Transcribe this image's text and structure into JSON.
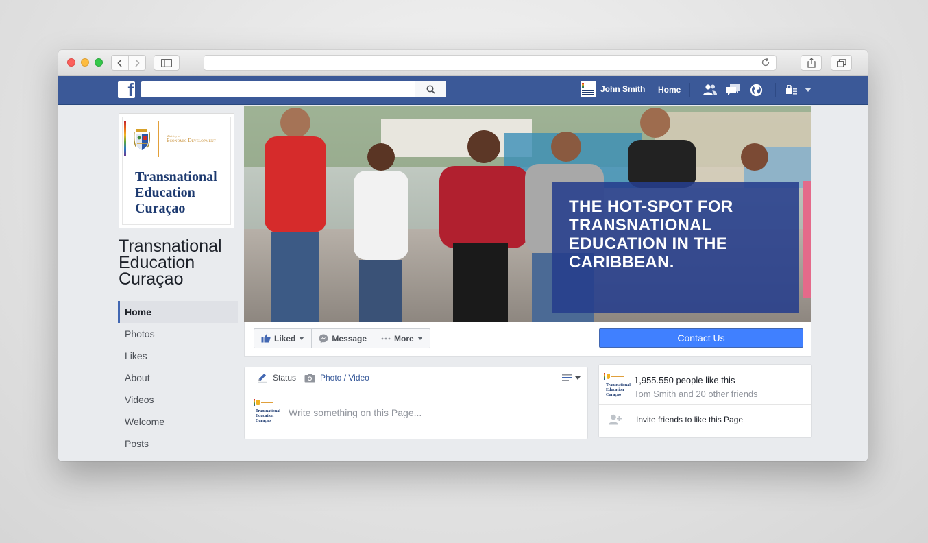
{
  "browser": {
    "address": ""
  },
  "topbar": {
    "search_placeholder": "",
    "user_name": "John Smith",
    "home_label": "Home"
  },
  "page": {
    "profile_title": "Transnational Education Curaçao",
    "ministry_small": "Ministry of",
    "ministry_big": "Economic Development",
    "name": "Transnational Education Curaçao",
    "nav": [
      {
        "label": "Home"
      },
      {
        "label": "Photos"
      },
      {
        "label": "Likes"
      },
      {
        "label": "About"
      },
      {
        "label": "Videos"
      },
      {
        "label": "Welcome"
      },
      {
        "label": "Posts"
      }
    ]
  },
  "cover": {
    "headline": "THE HOT-SPOT FOR TRANSNATIONAL EDUCATION IN THE CARIBBEAN."
  },
  "actions": {
    "liked": "Liked",
    "message": "Message",
    "more": "More",
    "contact": "Contact Us"
  },
  "composer": {
    "status": "Status",
    "photo_video": "Photo / Video",
    "placeholder": "Write something on this Page..."
  },
  "likes": {
    "count_text": "1,955.550 people like this",
    "friends_text": "Tom Smith and 20 other friends",
    "invite_text": "Invite friends to like this Page"
  },
  "colors": {
    "facebook_blue": "#3b5998",
    "contact_button": "#4080ff",
    "cover_overlay": "#263e8c"
  },
  "icons": [
    "search-icon",
    "friends-icon",
    "messages-icon",
    "globe-icon",
    "privacy-icon",
    "thumbs-up-icon",
    "messenger-icon",
    "pencil-icon",
    "camera-icon",
    "add-friend-icon"
  ]
}
